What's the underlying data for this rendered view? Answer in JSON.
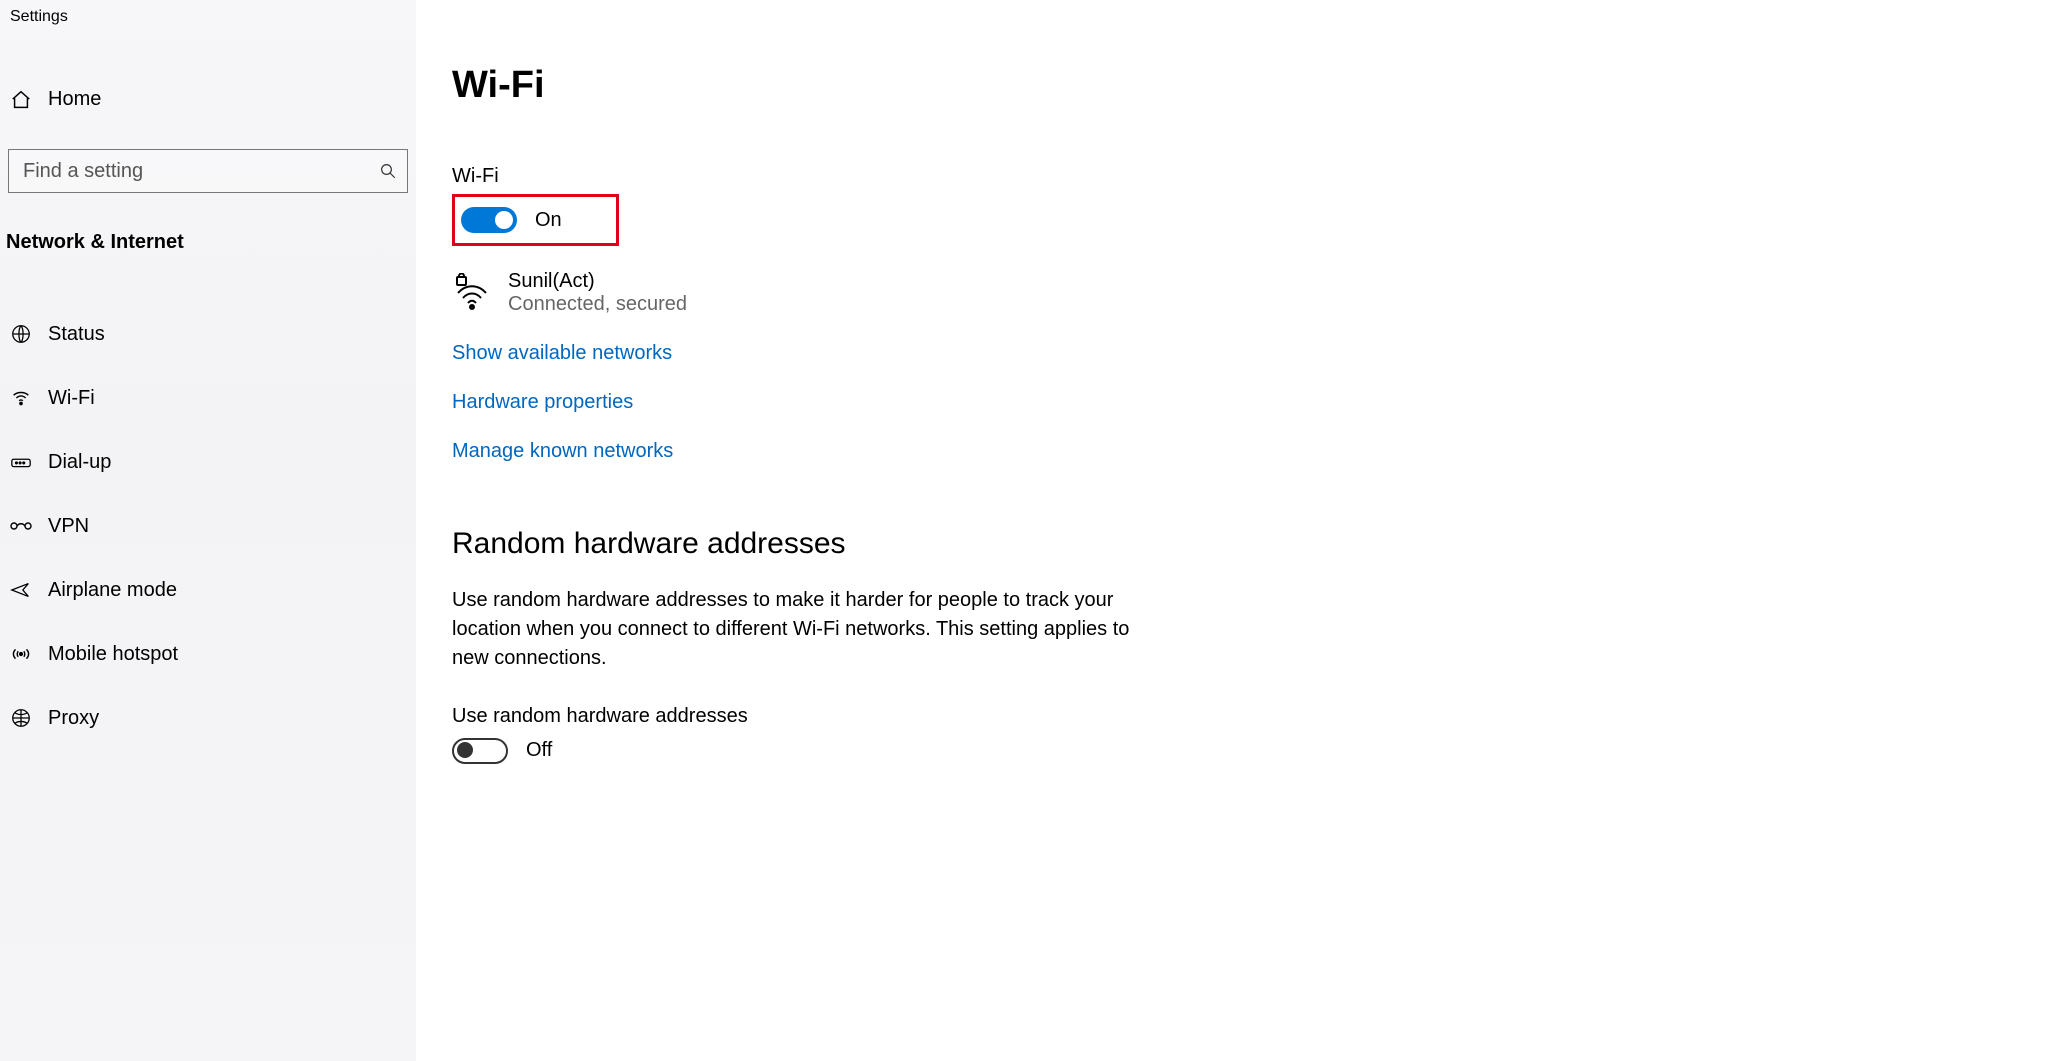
{
  "app_title": "Settings",
  "sidebar": {
    "home_label": "Home",
    "search_placeholder": "Find a setting",
    "section_title": "Network & Internet",
    "items": [
      {
        "label": "Status"
      },
      {
        "label": "Wi-Fi"
      },
      {
        "label": "Dial-up"
      },
      {
        "label": "VPN"
      },
      {
        "label": "Airplane mode"
      },
      {
        "label": "Mobile hotspot"
      },
      {
        "label": "Proxy"
      }
    ]
  },
  "main": {
    "page_title": "Wi-Fi",
    "wifi_label": "Wi-Fi",
    "wifi_toggle_state": "On",
    "connection": {
      "name": "Sunil(Act)",
      "status": "Connected, secured"
    },
    "links": {
      "show_networks": "Show available networks",
      "hardware_props": "Hardware properties",
      "manage_known": "Manage known networks"
    },
    "random_section": {
      "heading": "Random hardware addresses",
      "description": "Use random hardware addresses to make it harder for people to track your location when you connect to different Wi-Fi networks. This setting applies to new connections.",
      "toggle_label": "Use random hardware addresses",
      "toggle_state": "Off"
    }
  }
}
